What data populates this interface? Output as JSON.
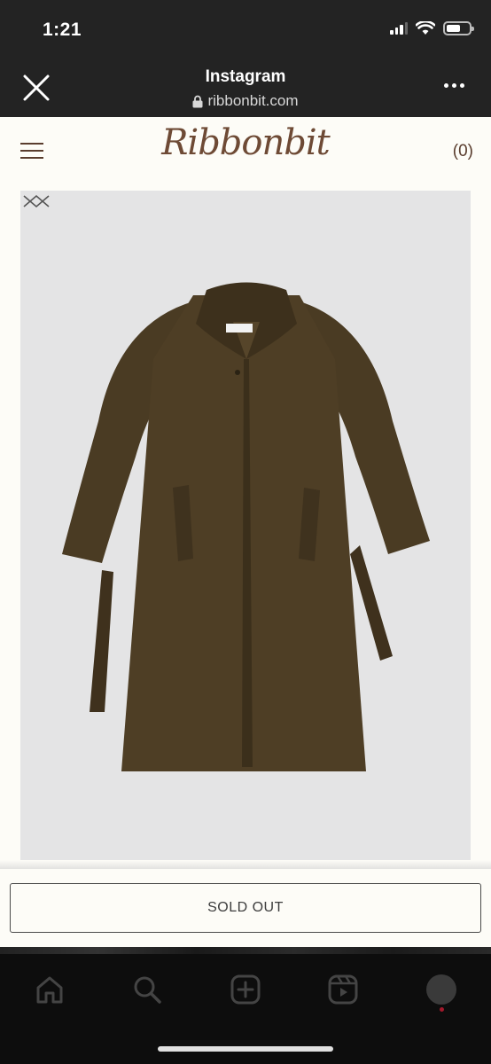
{
  "status_bar": {
    "time": "1:21"
  },
  "browser": {
    "title": "Instagram",
    "url": "ribbonbit.com"
  },
  "site": {
    "brand": "Ribbonbit",
    "cart_label": "(0)"
  },
  "product": {
    "button_label": "SOLD OUT",
    "coat_color": "#4a3b23"
  },
  "colors": {
    "page_bg": "#fdfcf7",
    "brand": "#6e4a35",
    "image_bg": "#e4e4e5",
    "nav_bg": "#0d0d0d"
  },
  "nav_icons": [
    "home-icon",
    "search-icon",
    "add-post-icon",
    "reels-icon",
    "profile-avatar"
  ]
}
